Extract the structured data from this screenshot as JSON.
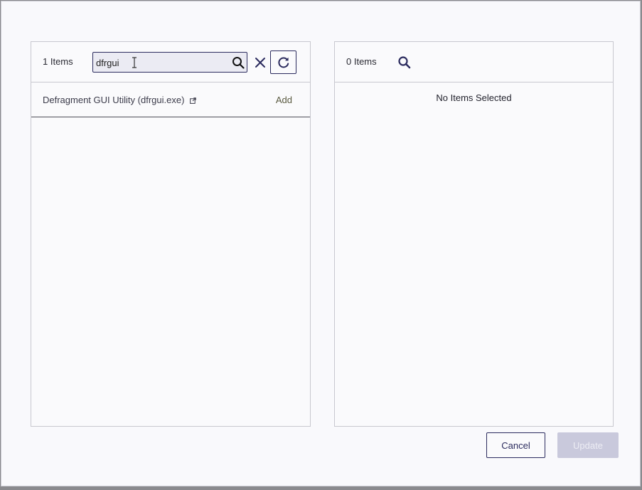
{
  "available": {
    "count_label": "1 Items",
    "search": {
      "value": "dfrgui",
      "placeholder": ""
    },
    "results": [
      {
        "name": "Defragment GUI Utility (dfrgui.exe)",
        "action": "Add"
      }
    ]
  },
  "selected": {
    "count_label": "0 Items",
    "empty_message": "No Items Selected"
  },
  "footer": {
    "cancel_label": "Cancel",
    "update_label": "Update"
  },
  "icons": {
    "search": "search-icon",
    "clear": "close-icon",
    "refresh": "refresh-icon",
    "external": "external-link-icon"
  },
  "colors": {
    "accent": "#2b2b5e",
    "disabled": "#c9c9dc",
    "background": "#f9f9fc"
  }
}
